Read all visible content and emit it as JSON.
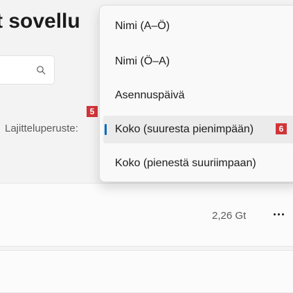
{
  "page": {
    "title": "t sovellu"
  },
  "search": {
    "value": ""
  },
  "sort": {
    "label": "Lajitteluperuste:"
  },
  "badges": {
    "sort_label": "5",
    "selected_option": "6"
  },
  "sort_menu": {
    "options": [
      {
        "label": "Nimi (A–Ö)"
      },
      {
        "label": "Nimi (Ö–A)"
      },
      {
        "label": "Asennuspäivä"
      },
      {
        "label": "Koko (suuresta pienimpään)"
      },
      {
        "label": "Koko (pienestä suuriimpaan)"
      }
    ],
    "selected": "Koko (suuresta pienimpään)"
  },
  "apps": [
    {
      "size": "2,26 Gt"
    }
  ],
  "colors": {
    "accent": "#0067c0",
    "badge": "#d13438"
  },
  "icons": {
    "search": "search-icon",
    "more": "more-icon"
  }
}
